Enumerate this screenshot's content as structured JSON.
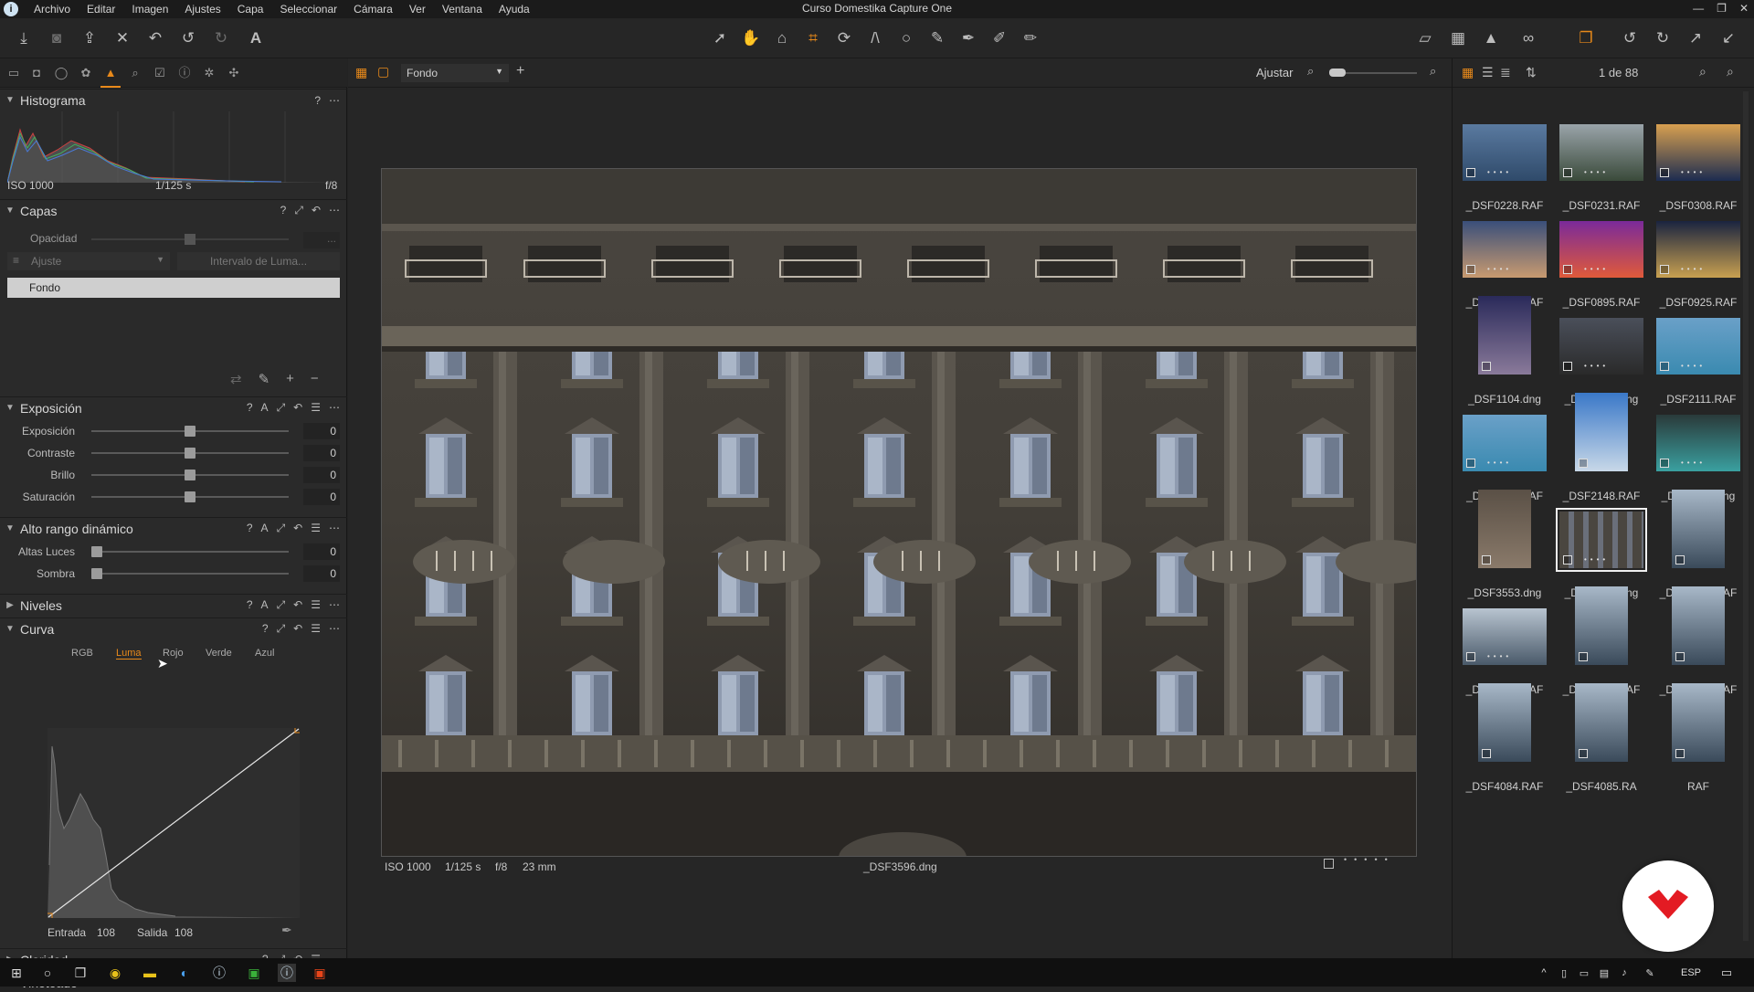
{
  "window": {
    "title": "Curso Domestika Capture One",
    "controls": [
      "—",
      "❐",
      "✕"
    ]
  },
  "menu": [
    "Archivo",
    "Editar",
    "Imagen",
    "Ajustes",
    "Capa",
    "Seleccionar",
    "Cámara",
    "Ver",
    "Ventana",
    "Ayuda"
  ],
  "histogram": {
    "title": "Histograma",
    "iso": "ISO 1000",
    "shutter": "1/125 s",
    "aperture": "f/8"
  },
  "capas": {
    "title": "Capas",
    "opacity_label": "Opacidad",
    "opacity_value": "...",
    "adjust_select": "Ajuste",
    "luma_range_button": "Intervalo de Luma...",
    "layers": [
      "Fondo"
    ]
  },
  "exposicion": {
    "title": "Exposición",
    "sliders": [
      {
        "label": "Exposición",
        "value": "0",
        "level": 0.5
      },
      {
        "label": "Contraste",
        "value": "0",
        "level": 0.5
      },
      {
        "label": "Brillo",
        "value": "0",
        "level": 0.5
      },
      {
        "label": "Saturación",
        "value": "0",
        "level": 0.5
      }
    ]
  },
  "hdr": {
    "title": "Alto rango dinámico",
    "sliders": [
      {
        "label": "Altas Luces",
        "value": "0",
        "level": 0
      },
      {
        "label": "Sombra",
        "value": "0",
        "level": 0
      }
    ]
  },
  "niveles": {
    "title": "Niveles"
  },
  "curva": {
    "title": "Curva",
    "tabs": [
      "RGB",
      "Luma",
      "Rojo",
      "Verde",
      "Azul"
    ],
    "active_tab": "Luma",
    "entrada_label": "Entrada",
    "entrada_value": "108",
    "salida_label": "Salida",
    "salida_value": "108"
  },
  "claridad": {
    "title": "Claridad"
  },
  "vineteado": {
    "title": "Viñeteado"
  },
  "viewer": {
    "layer_select": "Fondo",
    "fit_label": "Ajustar",
    "info": {
      "iso": "ISO 1000",
      "shutter": "1/125 s",
      "aperture": "f/8",
      "focal": "23 mm"
    },
    "filename": "_DSF3596.dng"
  },
  "browser": {
    "counter": "1 de 88",
    "thumbs": [
      {
        "name": "_DSF0228.RAF",
        "tone": "sea"
      },
      {
        "name": "_DSF0231.RAF",
        "tone": "cliff"
      },
      {
        "name": "_DSF0308.RAF",
        "tone": "sunset-blue"
      },
      {
        "name": "_DSF0309.RAF",
        "tone": "dusk"
      },
      {
        "name": "_DSF0895.RAF",
        "tone": "purple"
      },
      {
        "name": "_DSF0925.RAF",
        "tone": "night"
      },
      {
        "name": "_DSF1104.dng",
        "tone": "portrait-garden"
      },
      {
        "name": "_DSF1617.dng",
        "tone": "dark-sky"
      },
      {
        "name": "_DSF2111.RAF",
        "tone": "coast"
      },
      {
        "name": "_DSF2114.RAF",
        "tone": "coast"
      },
      {
        "name": "_DSF2148.RAF",
        "tone": "sky-portrait"
      },
      {
        "name": "_DSF2948.dng",
        "tone": "boat"
      },
      {
        "name": "_DSF3553.dng",
        "tone": "street"
      },
      {
        "name": "_DSF3596.dng",
        "tone": "building",
        "selected": true
      },
      {
        "name": "_DSF4080.RAF",
        "tone": "cloud-portrait"
      },
      {
        "name": "_DSF4081.RAF",
        "tone": "cloud"
      },
      {
        "name": "_DSF4082.RAF",
        "tone": "cloud-portrait"
      },
      {
        "name": "_DSF4083.RAF",
        "tone": "cloud-portrait"
      },
      {
        "name": "_DSF4084.RAF",
        "tone": "cloud-portrait"
      },
      {
        "name": "_DSF4085.RA",
        "tone": "cloud-portrait"
      },
      {
        "name": "RAF",
        "tone": "cloud-portrait"
      }
    ]
  },
  "taskbar": {
    "lang": "ESP"
  },
  "colors": {
    "accent": "#e8891a",
    "badge": "#e31b23"
  }
}
